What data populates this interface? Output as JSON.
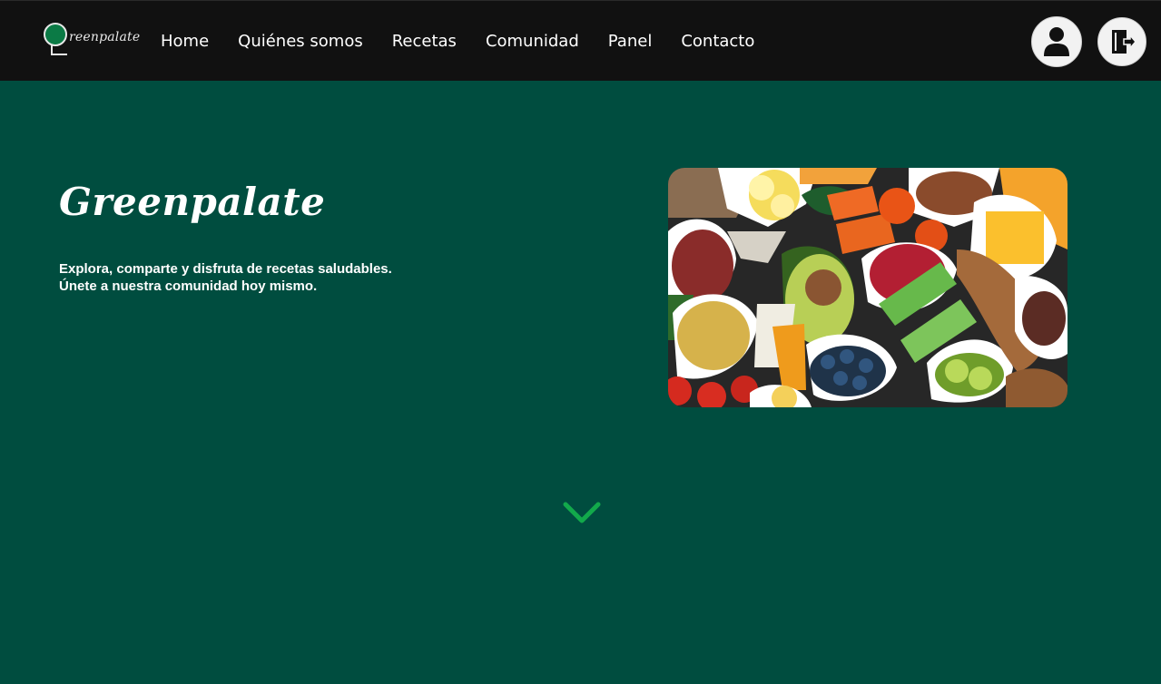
{
  "brand": {
    "logo_text": "reenpalate",
    "title": "Greenpalate"
  },
  "nav": {
    "items": [
      {
        "label": "Home"
      },
      {
        "label": "Quiénes somos"
      },
      {
        "label": "Recetas"
      },
      {
        "label": "Comunidad"
      },
      {
        "label": "Panel"
      },
      {
        "label": "Contacto"
      }
    ]
  },
  "header_actions": {
    "profile_icon": "user-icon",
    "logout_icon": "logout-icon"
  },
  "hero": {
    "title": "Greenpalate",
    "line1": "Explora, comparte y disfruta de recetas saludables.",
    "line2": "Únete a nuestra comunidad hoy mismo.",
    "image_subject": "healthy food bowls"
  },
  "scroll_icon": "chevron-down-icon",
  "colors": {
    "background": "#004d3f",
    "navbar": "#111111",
    "accent": "#12a94b"
  }
}
